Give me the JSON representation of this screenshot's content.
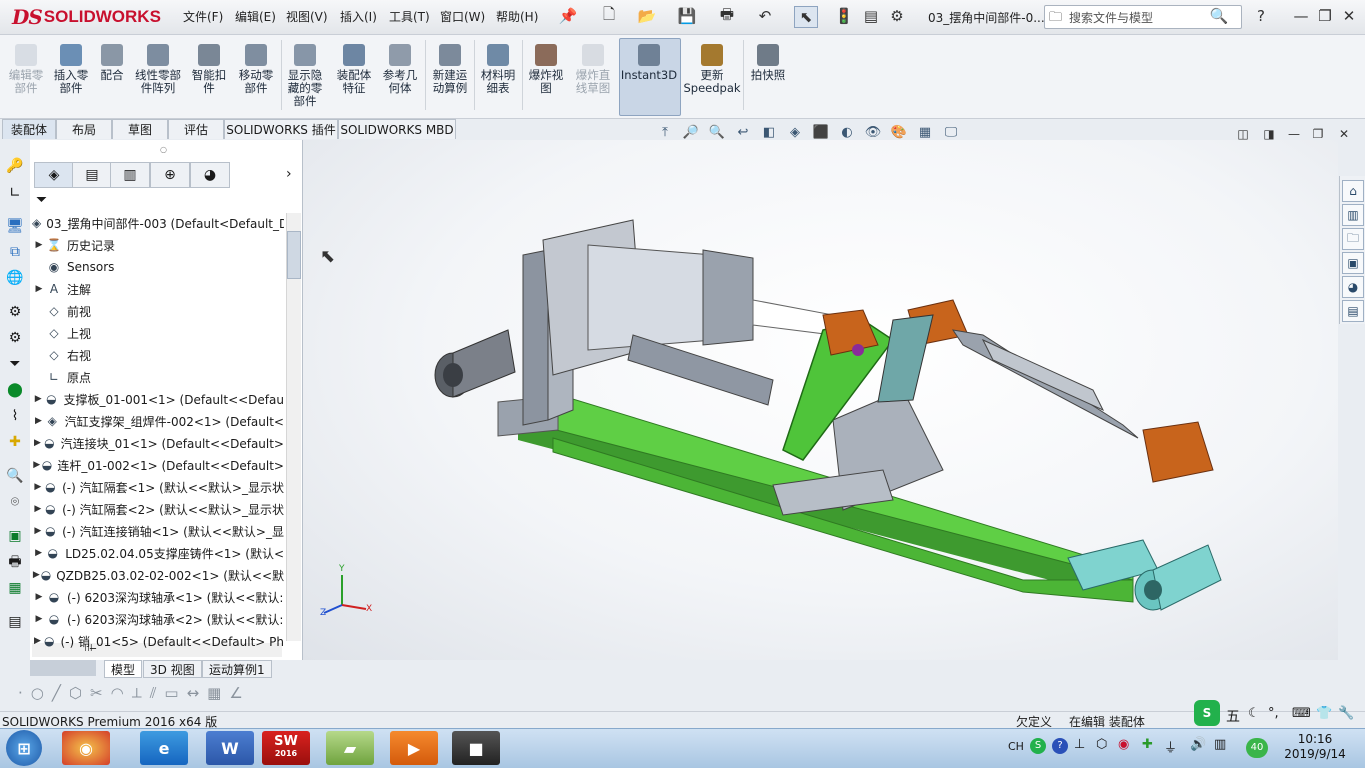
{
  "app": {
    "logo_ds": "DS",
    "logo_name": "SOLIDWORKS",
    "doc_title": "03_摆角中间部件-0...",
    "search_placeholder": "搜索文件与模型"
  },
  "menu": [
    "文件(F)",
    "编辑(E)",
    "视图(V)",
    "插入(I)",
    "工具(T)",
    "窗口(W)",
    "帮助(H)"
  ],
  "command_manager": [
    {
      "label": "编辑零部件",
      "disabled": true
    },
    {
      "label": "插入零部件",
      "disabled": false
    },
    {
      "label": "配合",
      "disabled": false
    },
    {
      "label": "线性零部件阵列",
      "disabled": false
    },
    {
      "label": "智能扣件",
      "disabled": false
    },
    {
      "label": "移动零部件",
      "disabled": false
    },
    {
      "label": "显示隐藏的零部件",
      "disabled": false
    },
    {
      "label": "装配体特征",
      "disabled": false
    },
    {
      "label": "参考几何体",
      "disabled": false
    },
    {
      "label": "新建运动算例",
      "disabled": false
    },
    {
      "label": "材料明细表",
      "disabled": false
    },
    {
      "label": "爆炸视图",
      "disabled": false
    },
    {
      "label": "爆炸直线草图",
      "disabled": true
    },
    {
      "label": "Instant3D",
      "disabled": false
    },
    {
      "label": "更新Speedpak",
      "disabled": false
    },
    {
      "label": "拍快照",
      "disabled": false
    }
  ],
  "tabs": [
    "装配体",
    "布局",
    "草图",
    "评估",
    "SOLIDWORKS 插件",
    "SOLIDWORKS MBD"
  ],
  "tree": {
    "root": "03_摆角中间部件-003  (Default<Default_D",
    "items": [
      {
        "label": "历史记录",
        "icon": "history-icon",
        "expand": true
      },
      {
        "label": "Sensors",
        "icon": "sensors-icon",
        "expand": false
      },
      {
        "label": "注解",
        "icon": "annotation-icon",
        "expand": true
      },
      {
        "label": "前视",
        "icon": "plane-icon",
        "expand": false
      },
      {
        "label": "上视",
        "icon": "plane-icon",
        "expand": false
      },
      {
        "label": "右视",
        "icon": "plane-icon",
        "expand": false
      },
      {
        "label": "原点",
        "icon": "origin-icon",
        "expand": false
      },
      {
        "label": "支撑板_01-001<1> (Default<<Defau",
        "icon": "part-icon",
        "expand": true
      },
      {
        "label": "汽缸支撑架_组焊件-002<1> (Default<",
        "icon": "assembly-icon",
        "expand": true
      },
      {
        "label": "汽连接块_01<1> (Default<<Default>",
        "icon": "part-icon",
        "expand": true
      },
      {
        "label": "连杆_01-002<1> (Default<<Default>",
        "icon": "part-icon",
        "expand": true
      },
      {
        "label": "(-) 汽缸隔套<1> (默认<<默认>_显示状",
        "icon": "part-icon",
        "expand": true
      },
      {
        "label": "(-) 汽缸隔套<2> (默认<<默认>_显示状",
        "icon": "part-icon",
        "expand": true
      },
      {
        "label": "(-) 汽缸连接销轴<1> (默认<<默认>_显",
        "icon": "part-icon",
        "expand": true
      },
      {
        "label": "LD25.02.04.05支撑座铸件<1> (默认<",
        "icon": "part-icon",
        "expand": true
      },
      {
        "label": "QZDB25.03.02-02-002<1> (默认<<默",
        "icon": "part-icon",
        "expand": true
      },
      {
        "label": "(-) 6203深沟球轴承<1> (默认<<默认:",
        "icon": "part-icon",
        "expand": true
      },
      {
        "label": "(-) 6203深沟球轴承<2> (默认<<默认:",
        "icon": "part-icon",
        "expand": true
      },
      {
        "label": "(-) 销_01<5> (Default<<Default> Ph",
        "icon": "part-icon",
        "expand": true
      }
    ]
  },
  "bottom_tabs": [
    "模型",
    "3D 视图",
    "运动算例1"
  ],
  "status": {
    "left": "SOLIDWORKS Premium 2016 x64 版",
    "mid1": "欠定义",
    "mid2": "在编辑 装配体"
  },
  "triad": {
    "x": "X",
    "y": "Y",
    "z": "Z"
  },
  "taskbar": {
    "clock_time": "10:16",
    "clock_date": "2019/9/14",
    "lang": "CH",
    "ime": "五",
    "notif": "40",
    "sw_year": "2016"
  },
  "colors": {
    "accent": "#c8102e",
    "green_part": "#5fcf45",
    "orange_part": "#c8641c",
    "gray_part": "#9aa2ad",
    "cyan_part": "#7fd3cf"
  }
}
